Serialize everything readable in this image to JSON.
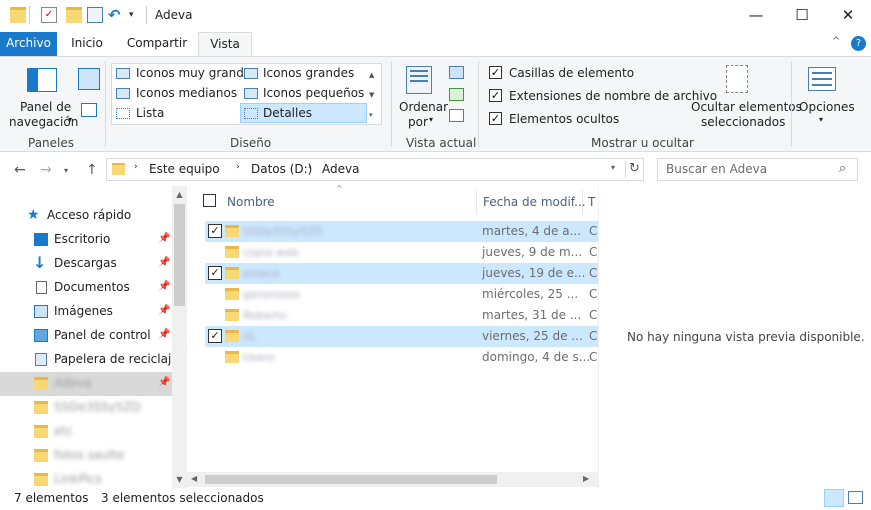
{
  "window": {
    "title": "Adeva",
    "minimize": "—",
    "maximize": "☐",
    "close": "✕"
  },
  "tabs": [
    {
      "label": "Archivo"
    },
    {
      "label": "Inicio"
    },
    {
      "label": "Compartir"
    },
    {
      "label": "Vista"
    }
  ],
  "ribbon": {
    "panels": {
      "nav_pane_line1": "Panel de",
      "nav_pane_line2": "navegación",
      "group": "Paneles"
    },
    "layout": {
      "options": [
        "Iconos muy grandes",
        "Iconos grandes",
        "Iconos medianos",
        "Iconos pequeños",
        "Lista",
        "Detalles"
      ],
      "selected": "Detalles",
      "group": "Diseño"
    },
    "current_view": {
      "sort_line1": "Ordenar",
      "sort_line2": "por",
      "group": "Vista actual"
    },
    "show_hide": {
      "item_checkboxes": "Casillas de elemento",
      "extensions": "Extensiones de nombre de archivo",
      "hidden_items": "Elementos ocultos",
      "hide_selected_line1": "Ocultar elementos",
      "hide_selected_line2": "seleccionados",
      "group": "Mostrar u ocultar"
    },
    "options": {
      "label": "Opciones"
    }
  },
  "address": {
    "path": [
      "Este equipo",
      "Datos (D:)",
      "Adeva"
    ],
    "search_placeholder": "Buscar en Adeva"
  },
  "nav_pane": {
    "quick_access": "Acceso rápido",
    "items": [
      {
        "label": "Escritorio"
      },
      {
        "label": "Descargas"
      },
      {
        "label": "Documentos"
      },
      {
        "label": "Imágenes"
      },
      {
        "label": "Panel de control"
      },
      {
        "label": "Papelera de reciclaje"
      },
      {
        "label": "Adeva"
      },
      {
        "label": "SSDe3SSy5ZD"
      },
      {
        "label": "etc"
      },
      {
        "label": "fotos saulte"
      },
      {
        "label": "LinkPics"
      }
    ]
  },
  "file_list": {
    "columns": {
      "name": "Nombre",
      "date": "Fecha de modif...",
      "type": "T"
    },
    "rows": [
      {
        "name": "SSDe3SSy5ZD",
        "date": "martes, 4 de a...",
        "selected": true
      },
      {
        "name": "copia web",
        "date": "jueves, 9 de m...",
        "selected": false
      },
      {
        "name": "enlace",
        "date": "jueves, 19 de e...",
        "selected": true
      },
      {
        "name": "generosos",
        "date": "miércoles, 25 ...",
        "selected": false
      },
      {
        "name": "Roberto",
        "date": "martes, 31 de ...",
        "selected": false
      },
      {
        "name": "dL",
        "date": "viernes, 25 de ...",
        "selected": true
      },
      {
        "name": "Usero",
        "date": "domingo, 4 de s...",
        "selected": false
      }
    ]
  },
  "preview": {
    "message": "No hay ninguna vista previa disponible."
  },
  "status": {
    "count": "7 elementos",
    "selected": "3 elementos seleccionados"
  }
}
